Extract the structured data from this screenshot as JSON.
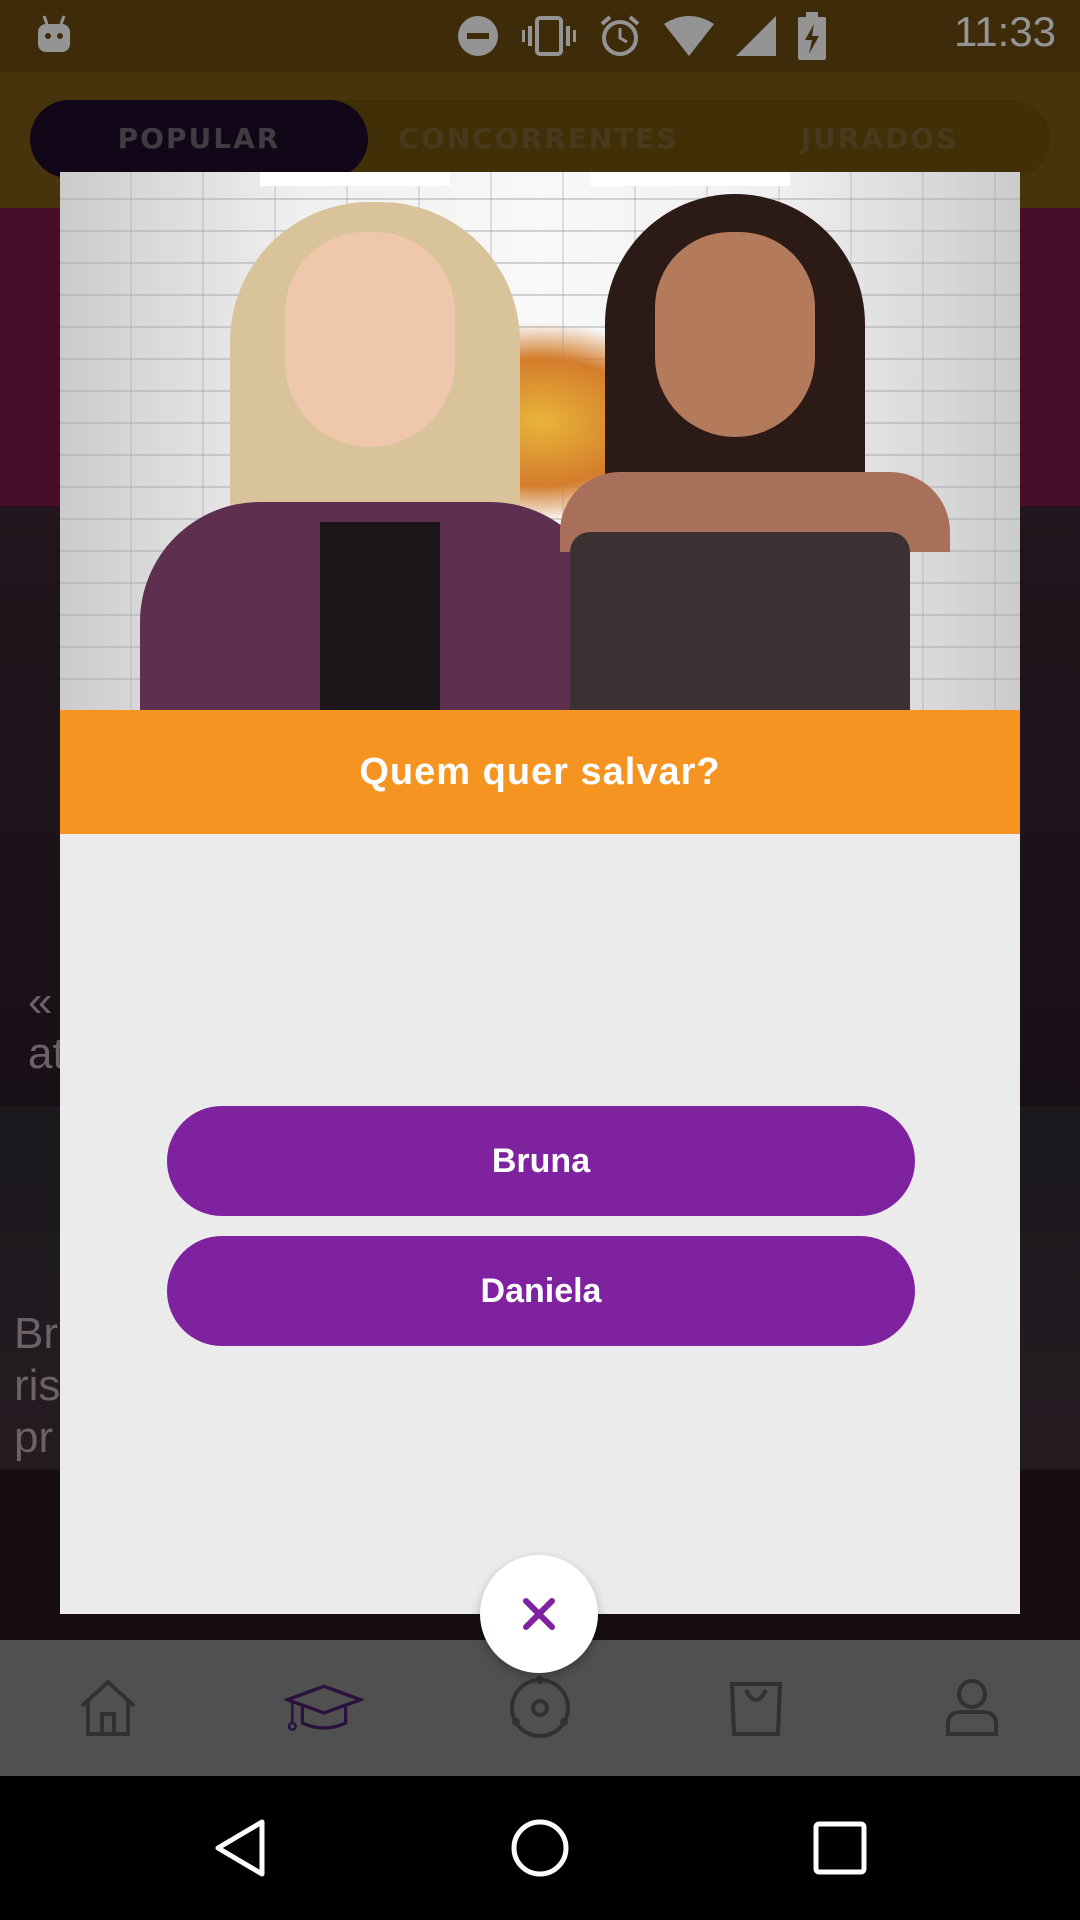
{
  "status_bar": {
    "time": "11:33",
    "icons": [
      "android-debug-icon",
      "do-not-disturb-icon",
      "vibrate-icon",
      "alarm-icon",
      "wifi-icon",
      "cell-signal-icon",
      "battery-charging-icon"
    ]
  },
  "tabs": [
    {
      "label": "POPULAR",
      "active": true
    },
    {
      "label": "CONCORRENTES",
      "active": false
    },
    {
      "label": "JURADOS",
      "active": false
    }
  ],
  "background_tiles": {
    "tile1_text": "« \nat",
    "tile2_text": "Br\nris\npr"
  },
  "bottom_nav": [
    "home-icon",
    "graduation-cap-icon",
    "vinyl-icon",
    "shopping-bag-icon",
    "profile-icon"
  ],
  "dialog": {
    "question": "Quem quer salvar?",
    "options": [
      "Bruna",
      "Daniela"
    ],
    "close_label": "×"
  },
  "colors": {
    "question_banner": "#f69422",
    "option_button": "#7e22a0",
    "close_icon": "#7e22a0"
  }
}
